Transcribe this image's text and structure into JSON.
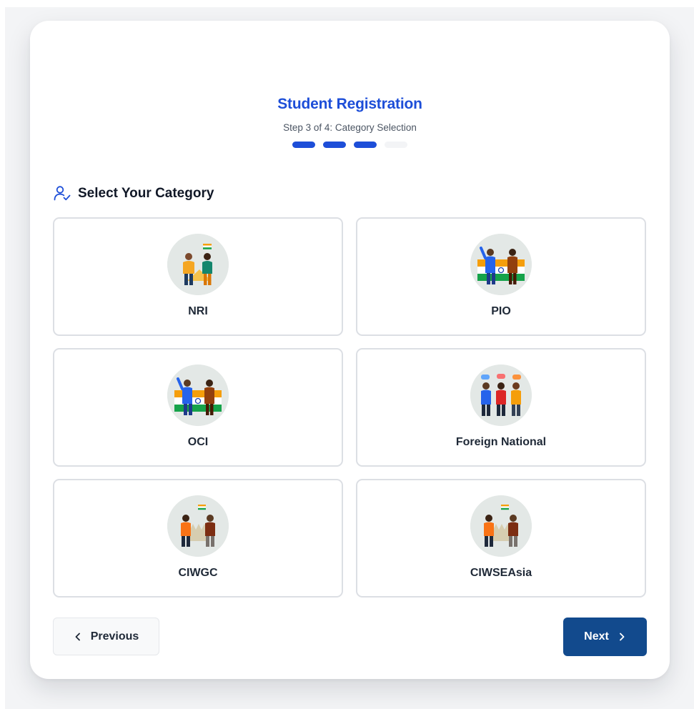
{
  "header": {
    "title": "Student Registration",
    "subtitle": "Step 3 of 4: Category Selection",
    "progress": {
      "current_step": 3,
      "total_steps": 4
    }
  },
  "section": {
    "title": "Select Your Category",
    "icon": "user-check-icon"
  },
  "categories": [
    {
      "label": "NRI",
      "illustration": "nri-illustration"
    },
    {
      "label": "PIO",
      "illustration": "pio-illustration"
    },
    {
      "label": "OCI",
      "illustration": "oci-illustration"
    },
    {
      "label": "Foreign National",
      "illustration": "foreign-national-illustration"
    },
    {
      "label": "CIWGC",
      "illustration": "ciwgc-illustration"
    },
    {
      "label": "CIWSEAsia",
      "illustration": "ciwseasia-illustration"
    }
  ],
  "navigation": {
    "previous_label": "Previous",
    "next_label": "Next"
  },
  "colors": {
    "accent": "#1d4ed8",
    "next_button": "#124a8d",
    "page_background": "#f3f4f6",
    "card_background": "#ffffff",
    "option_border": "#dcdfe4"
  }
}
